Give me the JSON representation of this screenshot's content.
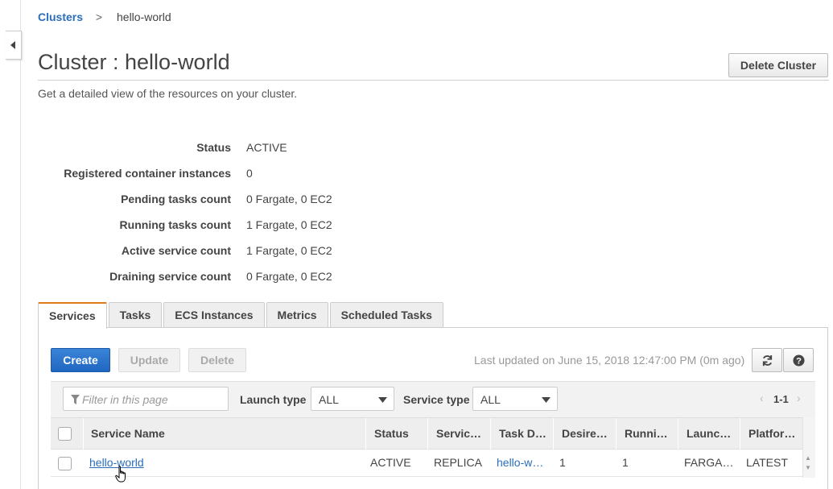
{
  "breadcrumb": {
    "root": "Clusters",
    "separator": ">",
    "current": "hello-world"
  },
  "page": {
    "title": "Cluster : hello-world",
    "subtitle": "Get a detailed view of the resources on your cluster.",
    "delete_button": "Delete Cluster"
  },
  "details": [
    {
      "label": "Status",
      "value": "ACTIVE"
    },
    {
      "label": "Registered container instances",
      "value": "0"
    },
    {
      "label": "Pending tasks count",
      "value": "0 Fargate, 0 EC2"
    },
    {
      "label": "Running tasks count",
      "value": "1 Fargate, 0 EC2"
    },
    {
      "label": "Active service count",
      "value": "1 Fargate, 0 EC2"
    },
    {
      "label": "Draining service count",
      "value": "0 Fargate, 0 EC2"
    }
  ],
  "tabs": [
    "Services",
    "Tasks",
    "ECS Instances",
    "Metrics",
    "Scheduled Tasks"
  ],
  "active_tab": "Services",
  "toolbar": {
    "create": "Create",
    "update": "Update",
    "delete": "Delete",
    "last_updated": "Last updated on June 15, 2018 12:47:00 PM (0m ago)",
    "refresh_icon": "refresh-icon",
    "help_icon": "help-icon"
  },
  "filters": {
    "filter_placeholder": "Filter in this page",
    "launch_type_label": "Launch type",
    "launch_type_value": "ALL",
    "service_type_label": "Service type",
    "service_type_value": "ALL",
    "pager_prev": "‹",
    "pager_range": "1-1",
    "pager_next": "›"
  },
  "table": {
    "columns": [
      "Service Name",
      "Status",
      "Servic…",
      "Task D…",
      "Desire…",
      "Runni…",
      "Launc…",
      "Platfor…"
    ],
    "rows": [
      {
        "service_name": "hello-world",
        "status": "ACTIVE",
        "service_type": "REPLICA",
        "task_def": "hello-w…",
        "desired": "1",
        "running": "1",
        "launch_type": "FARGA…",
        "platform": "LATEST"
      }
    ]
  },
  "colors": {
    "primary": "#2a6ebb",
    "create_button": "#1f66c0",
    "active_tab_accent": "#e07b15",
    "muted_text": "#999999"
  }
}
